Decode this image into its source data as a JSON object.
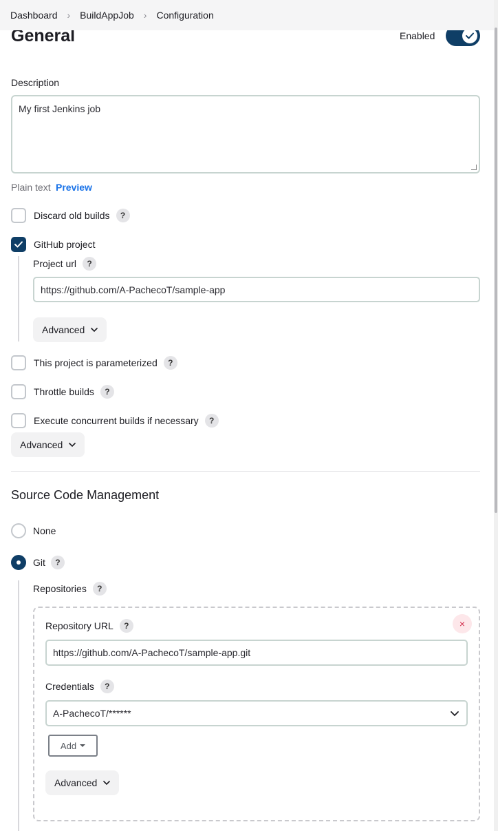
{
  "breadcrumb": {
    "items": [
      "Dashboard",
      "BuildAppJob",
      "Configuration"
    ]
  },
  "general": {
    "title": "General",
    "enabled_label": "Enabled",
    "enabled": true,
    "description_label": "Description",
    "description_value": "My first Jenkins job",
    "plain_text": "Plain text",
    "preview": "Preview",
    "options": {
      "discard_old_builds": {
        "label": "Discard old builds",
        "checked": false
      },
      "github_project": {
        "label": "GitHub project",
        "checked": true
      },
      "parameterized": {
        "label": "This project is parameterized",
        "checked": false
      },
      "throttle": {
        "label": "Throttle builds",
        "checked": false
      },
      "concurrent": {
        "label": "Execute concurrent builds if necessary",
        "checked": false
      }
    },
    "project_url_label": "Project url",
    "project_url_value": "https://github.com/A-PachecoT/sample-app",
    "advanced_label": "Advanced"
  },
  "scm": {
    "title": "Source Code Management",
    "options": [
      {
        "label": "None",
        "selected": false
      },
      {
        "label": "Git",
        "selected": true
      }
    ],
    "repositories_label": "Repositories",
    "repo_url_label": "Repository URL",
    "repo_url_value": "https://github.com/A-PachecoT/sample-app.git",
    "credentials_label": "Credentials",
    "credentials_value": "A-PachecoT/******",
    "add_label": "Add",
    "advanced_label": "Advanced"
  },
  "help_glyph": "?",
  "close_glyph": "×",
  "colors": {
    "accent": "#0f3e66",
    "link": "#1a73e8",
    "danger": "#d32f4d"
  }
}
